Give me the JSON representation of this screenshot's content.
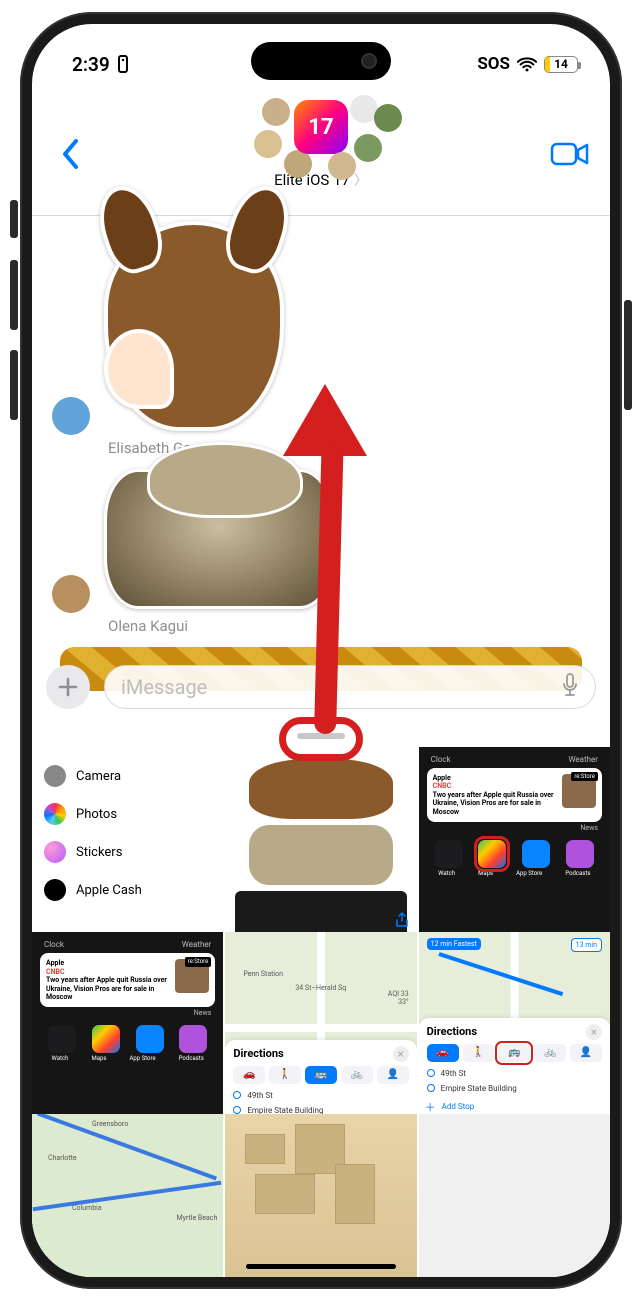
{
  "statusbar": {
    "time": "2:39",
    "sos": "SOS",
    "battery_pct": 14
  },
  "header": {
    "group_badge": "17",
    "group_name": "Elite iOS 17"
  },
  "conversation": {
    "msg1_sender": "Elisabeth Garry",
    "msg2_sender": "Olena Kagui"
  },
  "input": {
    "placeholder": "iMessage"
  },
  "drawer": {
    "apps": {
      "camera": "Camera",
      "photos": "Photos",
      "stickers": "Stickers",
      "apple_cash": "Apple Cash"
    }
  },
  "tiles": {
    "home": {
      "top_left": "Clock",
      "top_right": "Weather",
      "widget_vendor": "Apple",
      "widget_source": "CNBC",
      "widget_headline": "Two years after Apple quit Russia over Ukraine, Vision Pros are for sale in Moscow",
      "widget_tag": "re:Store",
      "widget_footer": "News",
      "app_watch": "Watch",
      "app_maps": "Maps",
      "app_appstore": "App Store",
      "app_podcasts": "Podcasts"
    },
    "map_mid": {
      "station": "Penn Station",
      "street": "34 St–Herald Sq",
      "aqi": "AQI 33",
      "temp": "33°"
    },
    "directions": {
      "title": "Directions",
      "stop1": "49th St",
      "stop2": "Empire State Building",
      "add_stop": "Add Stop"
    },
    "route": {
      "badge1": "12 min Fastest",
      "badge2": "13 min"
    },
    "greenmap": {
      "c1": "Greensboro",
      "c2": "Charlotte",
      "c3": "Columbia",
      "c4": "Myrtle Beach"
    }
  },
  "annotation": {
    "accent": "#d41f1f"
  }
}
